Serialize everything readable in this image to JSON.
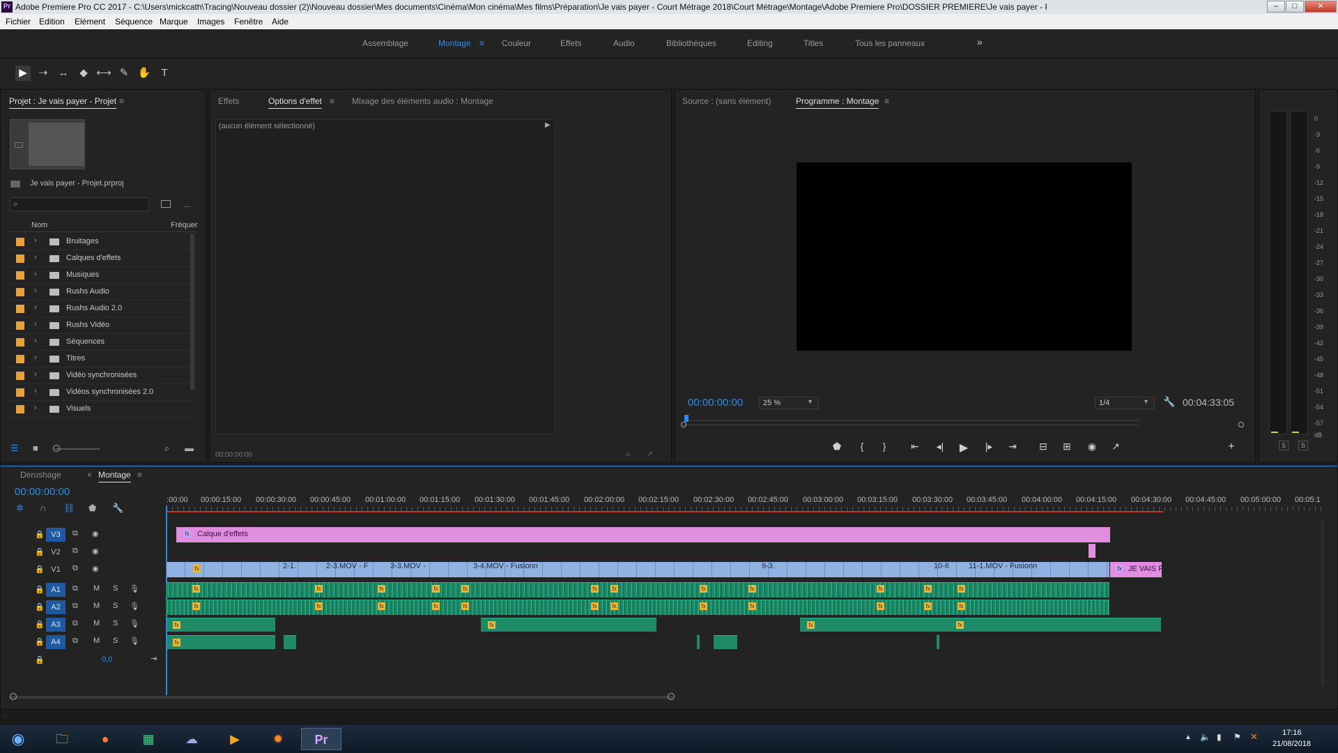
{
  "window": {
    "title": "Adobe Premiere Pro CC 2017 - C:\\Users\\mickcath\\Tracing\\Nouveau dossier (2)\\Nouveau dossier\\Mes documents\\Cinéma\\Mon cinéma\\Mes films\\Préparation\\Je vais payer - Court Métrage 2018\\Court Métrage\\Montage\\Adobe Premiere Pro\\DOSSIER PREMIERE\\Je vais payer - P",
    "app_icon": "Pr",
    "min": "–",
    "max": "□",
    "close": "✕"
  },
  "menu": [
    "Fichier",
    "Edition",
    "Elément",
    "Séquence",
    "Marque",
    "Images",
    "Fenêtre",
    "Aide"
  ],
  "workspaces": [
    "Assemblage",
    "Montage",
    "Couleur",
    "Effets",
    "Audio",
    "Bibliothèques",
    "Editing",
    "Titles",
    "Tous les panneaux"
  ],
  "workspace_menu_icon": "≡",
  "workspace_more": "»",
  "tools": [
    "▶",
    "⇢",
    "↔",
    "◆",
    "⟷",
    "✎",
    "✋",
    "T"
  ],
  "project": {
    "title": "Projet : Je vais payer - Projet",
    "menu": "≡",
    "file": "Je vais payer - Projet.prproj",
    "search_placeholder": "",
    "col_name": "Nom",
    "col_freq": "Fréquer",
    "items": [
      "Bruitages",
      "Calques d'effets",
      "Musiques",
      "Rushs Audio",
      "Rushs Audio 2.0",
      "Rushs Vidéo",
      "Séquences",
      "Titres",
      "Vidéo synchronisées",
      "Vidéos synchronisées 2.0",
      "Visuels"
    ],
    "more": "..."
  },
  "effects_panel": {
    "tabs": [
      "Effets",
      "Options d'effet",
      "Mixage des éléments audio : Montage"
    ],
    "menu": "≡",
    "no_selection": "(aucun élément sélectionné)",
    "timecode": "00:00:00:00"
  },
  "program": {
    "tabs": [
      "Source : (sans élément)",
      "Programme : Montage"
    ],
    "menu": "≡",
    "timecode": "00:00:00:00",
    "zoom": "25 %",
    "resolution": "1/4",
    "duration": "00:04:33:05",
    "playhead": 0
  },
  "meter": {
    "labels": [
      "0",
      "-3",
      "-6",
      "-9",
      "-12",
      "-15",
      "-18",
      "-21",
      "-24",
      "-27",
      "-30",
      "-33",
      "-36",
      "-39",
      "-42",
      "-45",
      "-48",
      "-51",
      "-54",
      "-57",
      "dB"
    ],
    "solo_left": "S",
    "solo_right": "S"
  },
  "timeline": {
    "tabs": [
      "Dérushage",
      "Montage"
    ],
    "close": "×",
    "menu": "≡",
    "timecode": "00:00:00:00",
    "ruler": [
      ":00:00",
      "00:00:15:00",
      "00:00:30:00",
      "00:00:45:00",
      "00:01:00:00",
      "00:01:15:00",
      "00:01:30:00",
      "00:01:45:00",
      "00:02:00:00",
      "00:02:15:00",
      "00:02:30:00",
      "00:02:45:00",
      "00:03:00:00",
      "00:03:15:00",
      "00:03:30:00",
      "00:03:45:00",
      "00:04:00:00",
      "00:04:15:00",
      "00:04:30:00",
      "00:04:45:00",
      "00:05:00:00",
      "00:05:1"
    ],
    "tracks": [
      "V3",
      "V2",
      "V1",
      "A1",
      "A2",
      "A3",
      "A4"
    ],
    "master": "0,0",
    "m": "M",
    "s": "S",
    "clips": {
      "layer": "Calque d'effets",
      "v1_labels": [
        "2-1.",
        "2-3.MOV - F",
        "3-3.MOV -",
        "3-4.MOV - Fusionn",
        "9-3.",
        "10-6",
        "11-1.MOV - Fusionn",
        "JE VAIS P"
      ]
    }
  },
  "taskbar": {
    "time": "17:16",
    "date": "21/08/2018"
  }
}
